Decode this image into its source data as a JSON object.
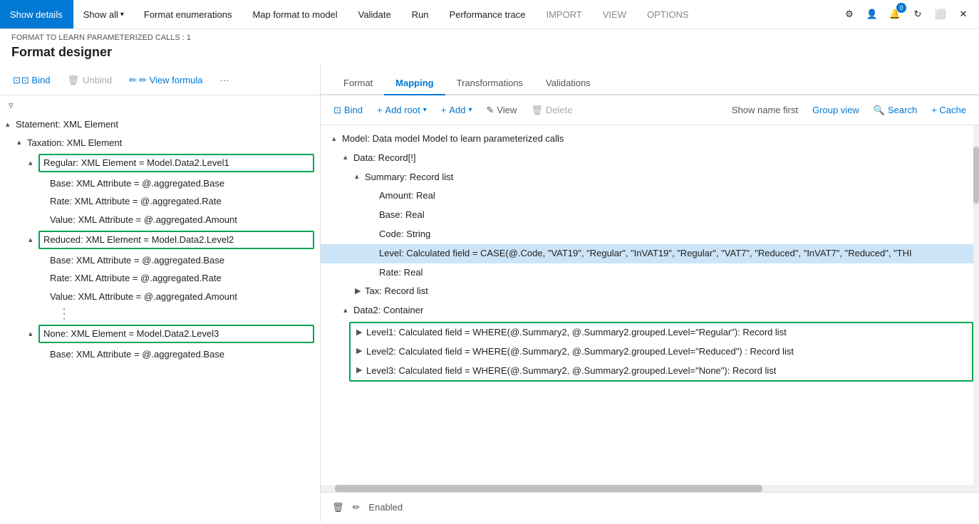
{
  "topNav": {
    "items": [
      {
        "id": "show-details",
        "label": "Show details",
        "active": true
      },
      {
        "id": "show-all",
        "label": "Show all",
        "hasDropdown": true,
        "active": false
      },
      {
        "id": "format-enumerations",
        "label": "Format enumerations",
        "active": false
      },
      {
        "id": "map-format-to-model",
        "label": "Map format to model",
        "active": false
      },
      {
        "id": "validate",
        "label": "Validate",
        "active": false
      },
      {
        "id": "run",
        "label": "Run",
        "active": false
      },
      {
        "id": "performance-trace",
        "label": "Performance trace",
        "active": false
      },
      {
        "id": "import",
        "label": "IMPORT",
        "active": false,
        "gray": true
      },
      {
        "id": "view",
        "label": "VIEW",
        "active": false,
        "gray": true
      },
      {
        "id": "options",
        "label": "OPTIONS",
        "active": false,
        "gray": true
      }
    ],
    "icons": [
      "settings",
      "user",
      "badge:0",
      "refresh",
      "restore",
      "close"
    ]
  },
  "subHeader": {
    "breadcrumb": "FORMAT TO LEARN PARAMETERIZED CALLS : 1"
  },
  "pageTitle": "Format designer",
  "leftToolbar": {
    "bind": "⊡ Bind",
    "unbind": "🗑 Unbind",
    "viewFormula": "✏ View formula",
    "more": "···"
  },
  "leftTree": {
    "items": [
      {
        "id": "statement",
        "label": "Statement: XML Element",
        "level": 0,
        "arrow": "▴",
        "highlighted": false
      },
      {
        "id": "taxation",
        "label": "Taxation: XML Element",
        "level": 1,
        "arrow": "▴",
        "highlighted": false
      },
      {
        "id": "regular",
        "label": "Regular: XML Element = Model.Data2.Level1",
        "level": 2,
        "arrow": "▴",
        "highlighted": true
      },
      {
        "id": "regular-base",
        "label": "Base: XML Attribute = @.aggregated.Base",
        "level": 3,
        "arrow": "",
        "highlighted": false
      },
      {
        "id": "regular-rate",
        "label": "Rate: XML Attribute = @.aggregated.Rate",
        "level": 3,
        "arrow": "",
        "highlighted": false
      },
      {
        "id": "regular-value",
        "label": "Value: XML Attribute = @.aggregated.Amount",
        "level": 3,
        "arrow": "",
        "highlighted": false
      },
      {
        "id": "reduced",
        "label": "Reduced: XML Element = Model.Data2.Level2",
        "level": 2,
        "arrow": "▴",
        "highlighted": true
      },
      {
        "id": "reduced-base",
        "label": "Base: XML Attribute = @.aggregated.Base",
        "level": 3,
        "arrow": "",
        "highlighted": false
      },
      {
        "id": "reduced-rate",
        "label": "Rate: XML Attribute = @.aggregated.Rate",
        "level": 3,
        "arrow": "",
        "highlighted": false
      },
      {
        "id": "reduced-value",
        "label": "Value: XML Attribute = @.aggregated.Amount",
        "level": 3,
        "arrow": "",
        "highlighted": false
      },
      {
        "id": "none",
        "label": "None: XML Element = Model.Data2.Level3",
        "level": 2,
        "arrow": "▴",
        "highlighted": true
      },
      {
        "id": "none-base",
        "label": "Base: XML Attribute = @.aggregated.Base",
        "level": 3,
        "arrow": "",
        "highlighted": false
      }
    ]
  },
  "tabs": [
    {
      "id": "format",
      "label": "Format",
      "active": false
    },
    {
      "id": "mapping",
      "label": "Mapping",
      "active": true
    },
    {
      "id": "transformations",
      "label": "Transformations",
      "active": false
    },
    {
      "id": "validations",
      "label": "Validations",
      "active": false
    }
  ],
  "rightToolbar": {
    "bind": "Bind",
    "addRoot": "Add root",
    "add": "Add",
    "view": "View",
    "delete": "Delete",
    "showNameFirst": "Show name first",
    "groupView": "Group view",
    "search": "Search",
    "cache": "+ Cache"
  },
  "rightTree": {
    "items": [
      {
        "id": "model-root",
        "label": "Model: Data model Model to learn parameterized calls",
        "level": 0,
        "arrow": "▴",
        "highlighted": false
      },
      {
        "id": "data",
        "label": "Data: Record[!]",
        "level": 1,
        "arrow": "▴",
        "highlighted": false
      },
      {
        "id": "summary",
        "label": "Summary: Record list",
        "level": 2,
        "arrow": "▴",
        "highlighted": false
      },
      {
        "id": "amount",
        "label": "Amount: Real",
        "level": 3,
        "arrow": "",
        "highlighted": false
      },
      {
        "id": "base",
        "label": "Base: Real",
        "level": 3,
        "arrow": "",
        "highlighted": false
      },
      {
        "id": "code",
        "label": "Code: String",
        "level": 3,
        "arrow": "",
        "highlighted": false
      },
      {
        "id": "level",
        "label": "Level: Calculated field = CASE(@.Code, \"VAT19\", \"Regular\", \"InVAT19\", \"Regular\", \"VAT7\", \"Reduced\", \"InVAT7\", \"Reduced\", \"THI",
        "level": 3,
        "arrow": "",
        "highlighted": false,
        "selected": true
      },
      {
        "id": "rate",
        "label": "Rate: Real",
        "level": 3,
        "arrow": "",
        "highlighted": false
      },
      {
        "id": "tax",
        "label": "Tax: Record list",
        "level": 2,
        "arrow": "▶",
        "highlighted": false
      },
      {
        "id": "data2",
        "label": "Data2: Container",
        "level": 1,
        "arrow": "▴",
        "highlighted": false
      },
      {
        "id": "level1",
        "label": "Level1: Calculated field = WHERE(@.Summary2, @.Summary2.grouped.Level=\"Regular\"): Record list",
        "level": 2,
        "arrow": "▶",
        "highlighted": true
      },
      {
        "id": "level2",
        "label": "Level2: Calculated field = WHERE(@.Summary2, @.Summary2.grouped.Level=\"Reduced\") : Record list",
        "level": 2,
        "arrow": "▶",
        "highlighted": true
      },
      {
        "id": "level3",
        "label": "Level3: Calculated field = WHERE(@.Summary2, @.Summary2.grouped.Level=\"None\"): Record list",
        "level": 2,
        "arrow": "▶",
        "highlighted": true
      }
    ]
  },
  "bottomBar": {
    "delete": "🗑",
    "edit": "✏",
    "status": "Enabled"
  },
  "colors": {
    "accent": "#0078d4",
    "green": "#00a651",
    "selectedBg": "#cce4f7"
  }
}
